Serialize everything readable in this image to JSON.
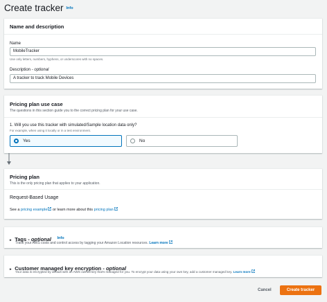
{
  "page": {
    "title": "Create tracker",
    "info_label": "Info"
  },
  "name_section": {
    "heading": "Name and description",
    "name_label": "Name",
    "name_value": "MobileTracker",
    "name_hint": "Use only letters, numbers, hyphens, or underscores with no spaces.",
    "description_label": "Description",
    "description_optional": "optional",
    "description_value": "A tracker to track Mobile Devices"
  },
  "pricing_use_case": {
    "heading": "Pricing plan use case",
    "description": "The questions in this section guide you to the correct pricing plan for your use case.",
    "question": "1. Will you use this tracker with simulated/Sample location data only?",
    "question_hint": "For example, when using it locally or in a test environment.",
    "options": [
      {
        "label": "Yes",
        "selected": true
      },
      {
        "label": "No",
        "selected": false
      }
    ]
  },
  "pricing_plan": {
    "heading": "Pricing plan",
    "description": "This is the only pricing plan that applies to your application.",
    "plan_name": "Request-Based Usage",
    "see_text": "See a",
    "pricing_example_link": "pricing example",
    "learn_more_text": "or learn more about this",
    "pricing_plan_link": "pricing plan"
  },
  "tags": {
    "heading": "Tags",
    "optional": "optional",
    "info_label": "Info",
    "description": "Track your AWS costs and control access by tagging your Amazon Location resources.",
    "learn_more": "Learn more"
  },
  "encryption": {
    "heading": "Customer managed key encryption",
    "optional": "optional",
    "description": "Your data is encrypted by default with an AWS owned key that's managed for you. To encrypt your data using your own key, add a customer managed key.",
    "learn_more": "Learn more"
  },
  "footer": {
    "cancel_label": "Cancel",
    "create_label": "Create tracker"
  },
  "colors": {
    "link": "#0073bb",
    "primary_button": "#ec7211",
    "background": "#f2f3f3"
  }
}
